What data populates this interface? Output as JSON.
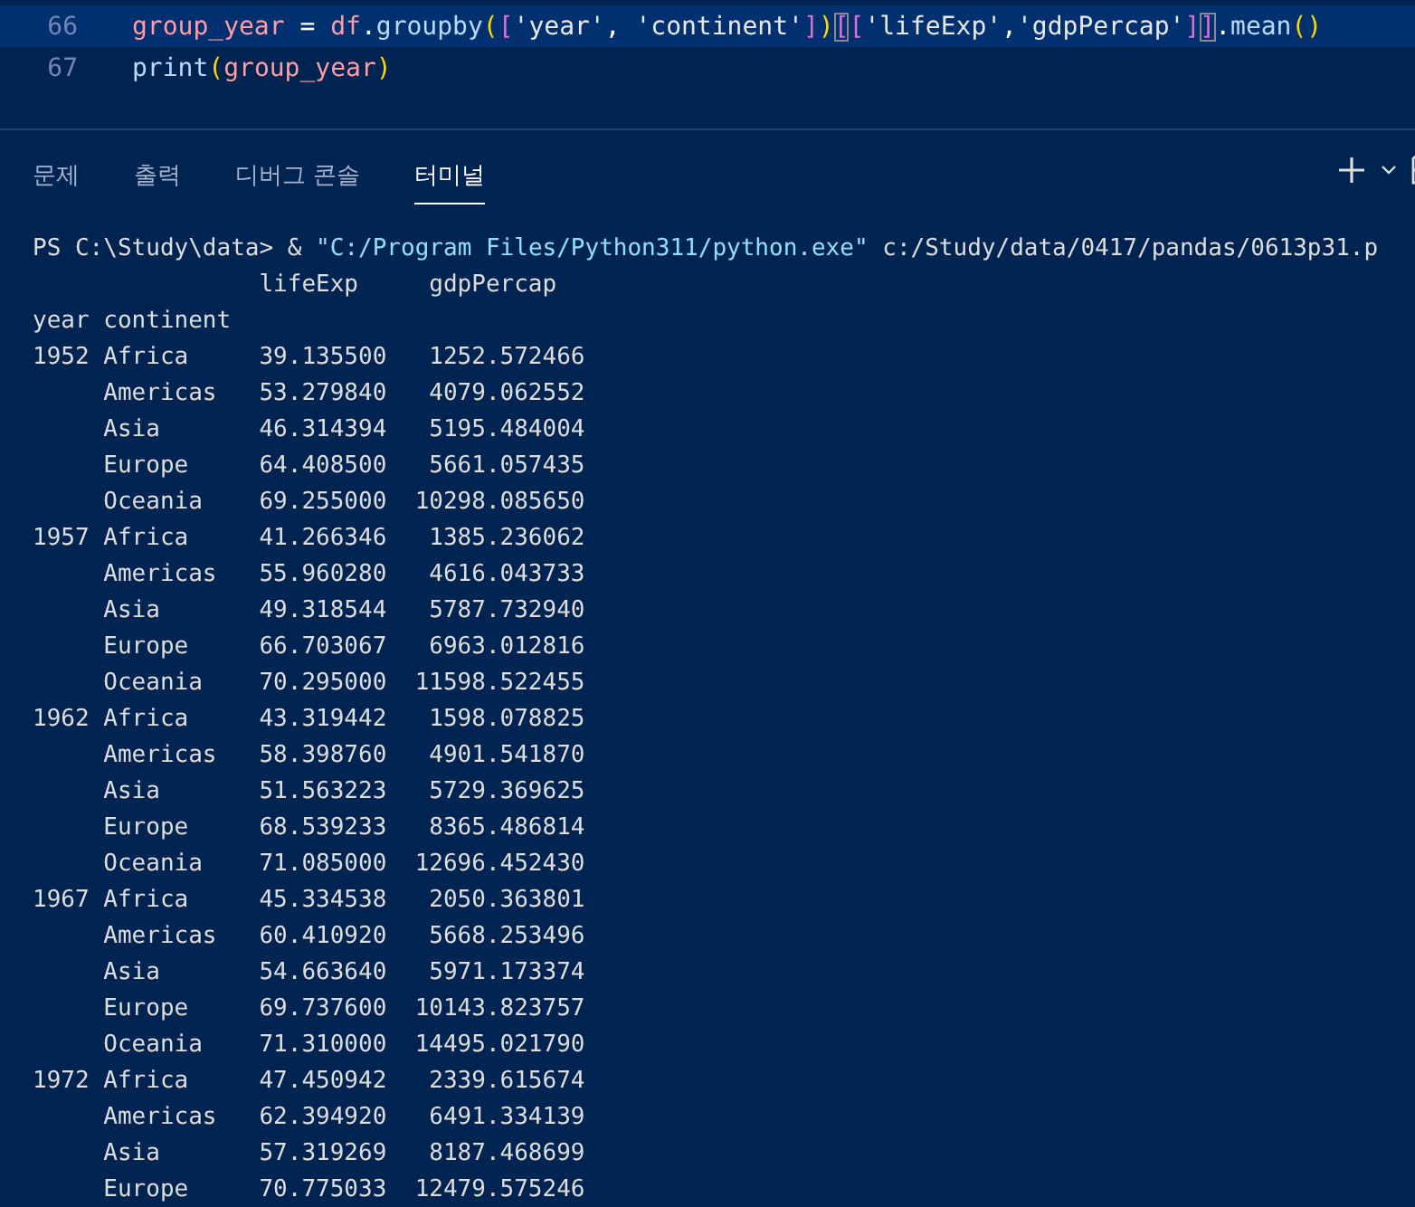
{
  "editor": {
    "lines": [
      {
        "number": "66",
        "highlighted": true,
        "tokens": [
          {
            "text": "group_year",
            "kind": "var"
          },
          {
            "text": " = ",
            "kind": "op"
          },
          {
            "text": "df",
            "kind": "var"
          },
          {
            "text": ".",
            "kind": "op"
          },
          {
            "text": "groupby",
            "kind": "func"
          },
          {
            "text": "(",
            "kind": "paren"
          },
          {
            "text": "[",
            "kind": "bracket"
          },
          {
            "text": "'year'",
            "kind": "string"
          },
          {
            "text": ", ",
            "kind": "op"
          },
          {
            "text": "'continent'",
            "kind": "string"
          },
          {
            "text": "]",
            "kind": "bracket"
          },
          {
            "text": ")",
            "kind": "paren"
          },
          {
            "text": "[",
            "kind": "match"
          },
          {
            "text": "[",
            "kind": "bracket"
          },
          {
            "text": "'lifeExp'",
            "kind": "string"
          },
          {
            "text": ",",
            "kind": "op"
          },
          {
            "text": "'gdpPercap'",
            "kind": "string"
          },
          {
            "text": "]",
            "kind": "bracket"
          },
          {
            "text": "]",
            "kind": "match"
          },
          {
            "text": ".",
            "kind": "op"
          },
          {
            "text": "mean",
            "kind": "func"
          },
          {
            "text": "()",
            "kind": "paren"
          }
        ]
      },
      {
        "number": "67",
        "highlighted": false,
        "tokens": [
          {
            "text": "print",
            "kind": "func"
          },
          {
            "text": "(",
            "kind": "paren"
          },
          {
            "text": "group_year",
            "kind": "var"
          },
          {
            "text": ")",
            "kind": "paren"
          }
        ]
      }
    ]
  },
  "panel": {
    "tabs": [
      {
        "label": "문제",
        "selected": false
      },
      {
        "label": "출력",
        "selected": false
      },
      {
        "label": "디버그 콘솔",
        "selected": false
      },
      {
        "label": "터미널",
        "selected": true
      }
    ]
  },
  "terminal": {
    "command": [
      {
        "text": "PS C:\\Study\\data> & ",
        "kind": "plain"
      },
      {
        "text": "\"C:/Program Files/Python311/python.exe\"",
        "kind": "string"
      },
      {
        "text": " c:/Study/data/0417/pandas/0613p31.p",
        "kind": "plain"
      }
    ],
    "output": [
      "                lifeExp     gdpPercap",
      "year continent                       ",
      "1952 Africa     39.135500   1252.572466",
      "     Americas   53.279840   4079.062552",
      "     Asia       46.314394   5195.484004",
      "     Europe     64.408500   5661.057435",
      "     Oceania    69.255000  10298.085650",
      "1957 Africa     41.266346   1385.236062",
      "     Americas   55.960280   4616.043733",
      "     Asia       49.318544   5787.732940",
      "     Europe     66.703067   6963.012816",
      "     Oceania    70.295000  11598.522455",
      "1962 Africa     43.319442   1598.078825",
      "     Americas   58.398760   4901.541870",
      "     Asia       51.563223   5729.369625",
      "     Europe     68.539233   8365.486814",
      "     Oceania    71.085000  12696.452430",
      "1967 Africa     45.334538   2050.363801",
      "     Americas   60.410920   5668.253496",
      "     Asia       54.663640   5971.173374",
      "     Europe     69.737600  10143.823757",
      "     Oceania    71.310000  14495.021790",
      "1972 Africa     47.450942   2339.615674",
      "     Americas   62.394920   6491.334139",
      "     Asia       57.319269   8187.468699",
      "     Europe     70.775033  12479.575246"
    ]
  }
}
